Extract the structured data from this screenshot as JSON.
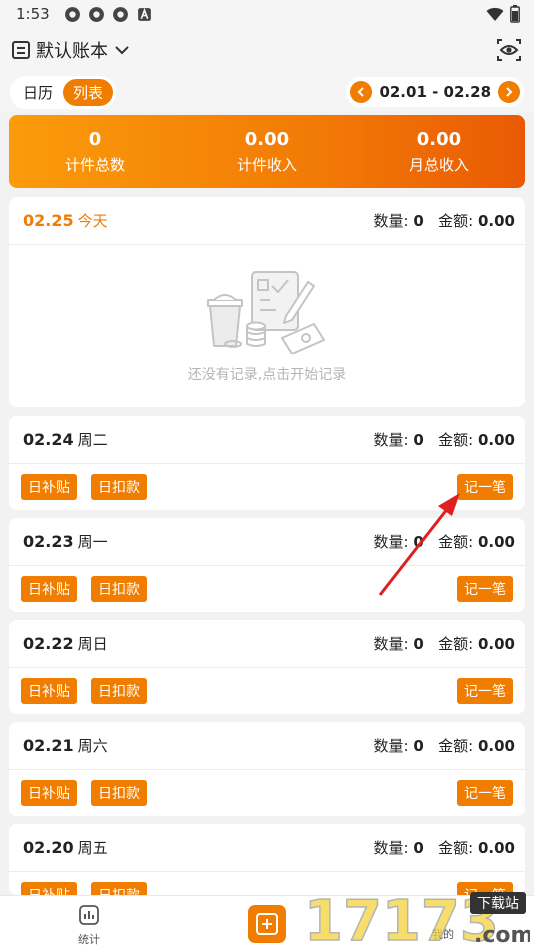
{
  "status_bar": {
    "time": "1:53"
  },
  "header": {
    "book_name": "默认账本"
  },
  "view_tabs": [
    {
      "label": "日历",
      "active": false
    },
    {
      "label": "列表",
      "active": true
    }
  ],
  "date_range": "02.01 - 02.28",
  "summary": [
    {
      "value": "0",
      "label": "计件总数"
    },
    {
      "value": "0.00",
      "label": "计件收入"
    },
    {
      "value": "0.00",
      "label": "月总收入"
    }
  ],
  "today": {
    "date": "02.25",
    "weekday": "今天",
    "quantity_label": "数量:",
    "quantity": "0",
    "amount_label": "金额:",
    "amount": "0.00",
    "empty_text": "还没有记录,点击开始记录"
  },
  "days": [
    {
      "date": "02.24",
      "weekday": "周二",
      "quantity_label": "数量:",
      "quantity": "0",
      "amount_label": "金额:",
      "amount": "0.00",
      "subsidy": "日补贴",
      "deduction": "日扣款",
      "record": "记一笔"
    },
    {
      "date": "02.23",
      "weekday": "周一",
      "quantity_label": "数量:",
      "quantity": "0",
      "amount_label": "金额:",
      "amount": "0.00",
      "subsidy": "日补贴",
      "deduction": "日扣款",
      "record": "记一笔"
    },
    {
      "date": "02.22",
      "weekday": "周日",
      "quantity_label": "数量:",
      "quantity": "0",
      "amount_label": "金额:",
      "amount": "0.00",
      "subsidy": "日补贴",
      "deduction": "日扣款",
      "record": "记一笔"
    },
    {
      "date": "02.21",
      "weekday": "周六",
      "quantity_label": "数量:",
      "quantity": "0",
      "amount_label": "金额:",
      "amount": "0.00",
      "subsidy": "日补贴",
      "deduction": "日扣款",
      "record": "记一笔"
    },
    {
      "date": "02.20",
      "weekday": "周五",
      "quantity_label": "数量:",
      "quantity": "0",
      "amount_label": "金额:",
      "amount": "0.00",
      "subsidy": "日补贴",
      "deduction": "日扣款",
      "record": "记一笔"
    }
  ],
  "bottom_nav": {
    "stats_label": "统计",
    "mine_label": "我的"
  },
  "watermark": {
    "number": "17173",
    "badge": "下载站",
    "domain": ".com"
  },
  "colors": {
    "accent": "#f07c00",
    "arrow": "#e02020"
  },
  "icons": [
    "book-icon",
    "chevron-down-icon",
    "eye-icon",
    "chevron-left-icon",
    "chevron-right-icon",
    "empty-records-illustration",
    "bar-chart-icon",
    "add-icon"
  ]
}
